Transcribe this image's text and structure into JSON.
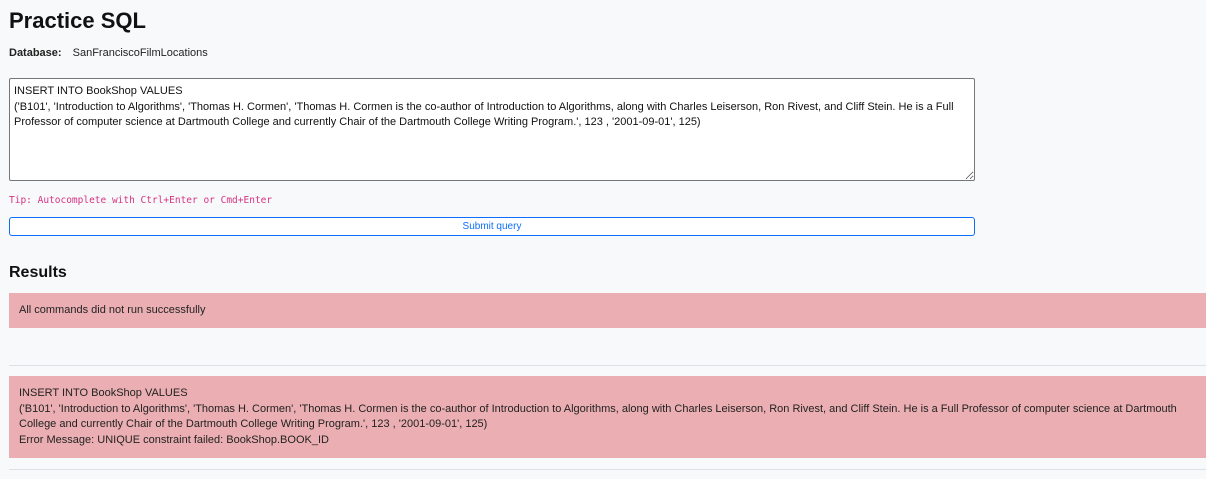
{
  "page": {
    "title": "Practice SQL"
  },
  "database": {
    "label": "Database:",
    "value": "SanFranciscoFilmLocations"
  },
  "editor": {
    "value": "INSERT INTO BookShop VALUES\n('B101', 'Introduction to Algorithms', 'Thomas H. Cormen', 'Thomas H. Cormen is the co-author of Introduction to Algorithms, along with Charles Leiserson, Ron Rivest, and Cliff Stein. He is a Full Professor of computer science at Dartmouth College and currently Chair of the Dartmouth College Writing Program.', 123 , '2001-09-01', 125)"
  },
  "tip": {
    "text": "Tip: Autocomplete with Ctrl+Enter or Cmd+Enter"
  },
  "submit": {
    "label": "Submit query"
  },
  "results": {
    "heading": "Results",
    "summary": "All commands did not run successfully",
    "error": {
      "statement_line1": "INSERT INTO BookShop VALUES",
      "statement_line2": "('B101', 'Introduction to Algorithms', 'Thomas H. Cormen', 'Thomas H. Cormen is the co-author of Introduction to Algorithms, along with Charles Leiserson, Ron Rivest, and Cliff Stein. He is a Full Professor of computer science at Dartmouth College and currently Chair of the Dartmouth College Writing Program.', 123 , '2001-09-01', 125)",
      "message": "Error Message: UNIQUE constraint failed: BookShop.BOOK_ID"
    }
  },
  "colors": {
    "background": "#f8f9fa",
    "error_alert": "#ebafb3",
    "tip": "#d63384",
    "primary": "#0d6efd"
  }
}
